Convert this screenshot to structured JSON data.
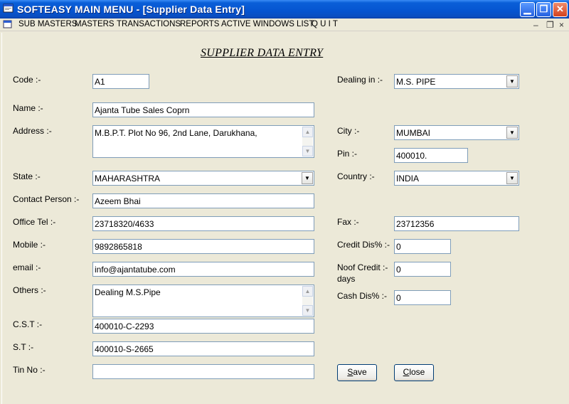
{
  "window": {
    "title": "SOFTEASY MAIN MENU - [Supplier Data Entry]"
  },
  "menu": {
    "items": [
      "SUB MASTERS",
      "MASTERS",
      "TRANSACTIONS",
      "REPORTS",
      "ACTIVE WINDOWS LIST",
      "Q U I T"
    ]
  },
  "form": {
    "title": "SUPPLIER DATA ENTRY",
    "labels": {
      "code": "Code :-",
      "name": "Name :-",
      "address": "Address :-",
      "state": "State :-",
      "contact_person": "Contact Person :-",
      "office_tel": "Office Tel :-",
      "mobile": "Mobile :-",
      "email": "email :-",
      "others": "Others :-",
      "cst": "C.S.T :-",
      "st": "S.T :-",
      "tin_no": "Tin No :-",
      "dealing_in": "Dealing in :-",
      "city": "City :-",
      "pin": "Pin :-",
      "country": "Country :-",
      "fax": "Fax :-",
      "credit_dis": "Credit Dis% :-",
      "noof_credit_line1": "Noof Credit :-",
      "noof_credit_line2": "days",
      "cash_dis": "Cash Dis% :-"
    },
    "values": {
      "code": "A1",
      "name": "Ajanta Tube Sales Coprn",
      "address": "M.B.P.T. Plot No 96, 2nd Lane, Darukhana,",
      "state": "MAHARASHTRA",
      "contact_person": "Azeem Bhai",
      "office_tel": "23718320/4633",
      "mobile": "9892865818",
      "email": "info@ajantatube.com",
      "others": "Dealing M.S.Pipe",
      "cst": "400010-C-2293",
      "st": "400010-S-2665",
      "tin_no": "",
      "dealing_in": "M.S. PIPE",
      "city": "MUMBAI",
      "pin": "400010.",
      "country": "INDIA",
      "fax": "23712356",
      "credit_dis": "0",
      "noof_credit_days": "0",
      "cash_dis": "0"
    },
    "buttons": {
      "save_first": "S",
      "save_rest": "ave",
      "close_first": "C",
      "close_rest": "lose"
    }
  },
  "icons": {
    "app": "app-window-icon",
    "minimize": "minimize-icon",
    "restore": "restore-icon",
    "close": "close-icon",
    "dropdown": "chevron-down-icon",
    "scroll_up": "scroll-up-icon",
    "scroll_down": "scroll-down-icon"
  }
}
